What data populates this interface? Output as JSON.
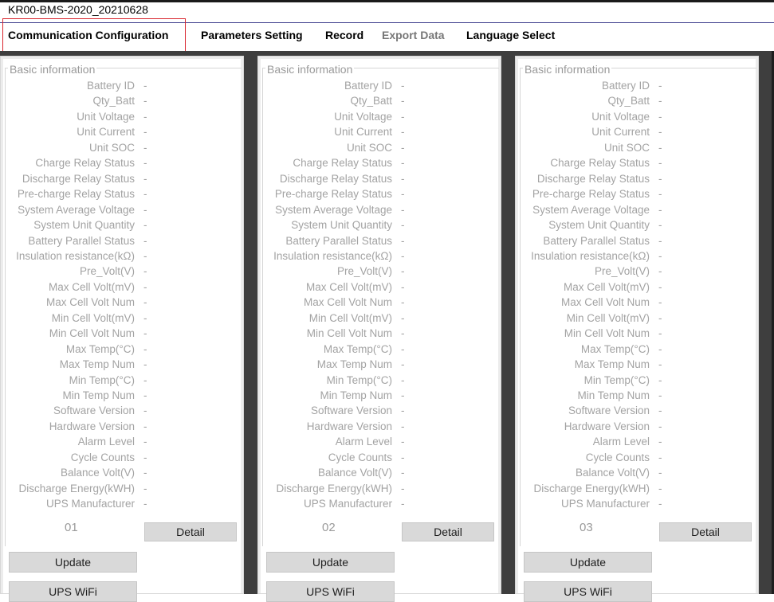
{
  "window": {
    "title": "KR00-BMS-2020_20210628"
  },
  "menu": {
    "items": [
      {
        "label": "Communication Configuration",
        "disabled": false
      },
      {
        "label": "Parameters Setting",
        "disabled": false
      },
      {
        "label": "Record",
        "disabled": false
      },
      {
        "label": "Export Data",
        "disabled": true
      },
      {
        "label": "Language Select",
        "disabled": false
      }
    ]
  },
  "fields": [
    "Battery ID",
    "Qty_Batt",
    "Unit Voltage",
    "Unit Current",
    "Unit SOC",
    "Charge Relay Status",
    "Discharge Relay Status",
    "Pre-charge Relay Status",
    "System Average Voltage",
    "System Unit Quantity",
    "Battery Parallel Status",
    "Insulation resistance(kΩ)",
    "Pre_Volt(V)",
    "Max Cell Volt(mV)",
    "Max Cell Volt Num",
    "Min Cell Volt(mV)",
    "Min Cell Volt Num",
    "Max Temp(°C)",
    "Max Temp Num",
    "Min Temp(°C)",
    "Min Temp Num",
    "Software Version",
    "Hardware Version",
    "Alarm Level",
    "Cycle Counts",
    "Balance Volt(V)",
    "Discharge Energy(kWH)",
    "UPS Manufacturer"
  ],
  "panels": [
    {
      "group_title": "Basic information",
      "unit_number": "01",
      "detail_label": "Detail",
      "update_label": "Update",
      "wifi_label": "UPS   WiFi",
      "values": [
        "-",
        "-",
        "-",
        "-",
        "-",
        "-",
        "-",
        "-",
        "-",
        "-",
        "-",
        "-",
        "-",
        "-",
        "-",
        "-",
        "-",
        "-",
        "-",
        "-",
        "-",
        "-",
        "-",
        "-",
        "-",
        "-",
        "-",
        "-"
      ]
    },
    {
      "group_title": "Basic information",
      "unit_number": "02",
      "detail_label": "Detail",
      "update_label": "Update",
      "wifi_label": "UPS   WiFi",
      "values": [
        "-",
        "-",
        "-",
        "-",
        "-",
        "-",
        "-",
        "-",
        "-",
        "-",
        "-",
        "-",
        "-",
        "-",
        "-",
        "-",
        "-",
        "-",
        "-",
        "-",
        "-",
        "-",
        "-",
        "-",
        "-",
        "-",
        "-",
        "-"
      ]
    },
    {
      "group_title": "Basic information",
      "unit_number": "03",
      "detail_label": "Detail",
      "update_label": "Update",
      "wifi_label": "UPS   WiFi",
      "values": [
        "-",
        "-",
        "-",
        "-",
        "-",
        "-",
        "-",
        "-",
        "-",
        "-",
        "-",
        "-",
        "-",
        "-",
        "-",
        "-",
        "-",
        "-",
        "-",
        "-",
        "-",
        "-",
        "-",
        "-",
        "-",
        "-",
        "-",
        "-"
      ]
    }
  ]
}
